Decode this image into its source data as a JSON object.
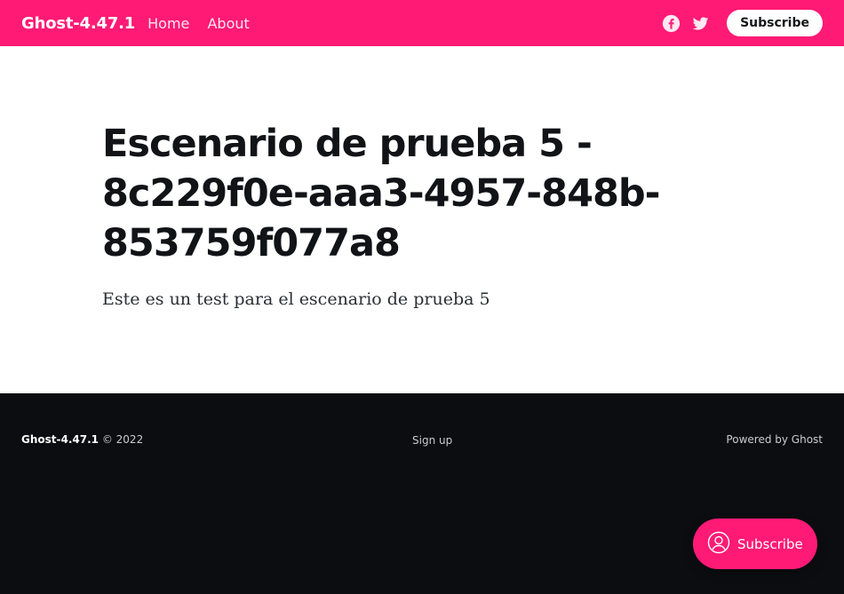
{
  "header": {
    "site_title": "Ghost-4.47.1",
    "nav": [
      {
        "label": "Home"
      },
      {
        "label": "About"
      }
    ],
    "social_icons": [
      "facebook-icon",
      "twitter-icon"
    ],
    "subscribe_label": "Subscribe"
  },
  "post": {
    "title": "Escenario de prueba 5 - 8c229f0e-aaa3-4957-848b-853759f077a8",
    "excerpt": "Este es un test para el escenario de prueba 5"
  },
  "footer": {
    "site_title": "Ghost-4.47.1",
    "copyright": "© 2022",
    "signup_label": "Sign up",
    "powered_by": "Powered by Ghost"
  },
  "portal": {
    "label": "Subscribe",
    "icon": "user-icon"
  },
  "colors": {
    "accent": "#ff1a75",
    "footer_bg": "#0c0d10",
    "text": "#111317"
  }
}
